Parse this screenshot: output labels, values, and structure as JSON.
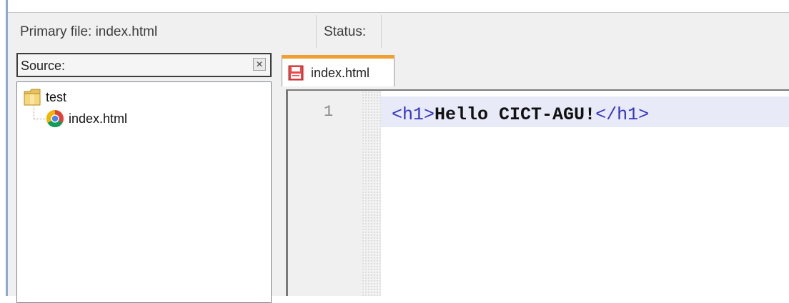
{
  "statusbar": {
    "primary_file": "Primary file: index.html",
    "status": "Status:"
  },
  "source_panel": {
    "title": "Source:",
    "close_icon": "close-icon",
    "tree": [
      {
        "label": "test",
        "icon": "folder-icon"
      },
      {
        "label": "index.html",
        "icon": "chrome-icon"
      }
    ]
  },
  "editor": {
    "tab": {
      "label": "index.html",
      "icon": "html-file-icon"
    },
    "lines": [
      {
        "number": "1",
        "tag_open": "<h1>",
        "text": "Hello CICT-AGU!",
        "tag_close": "</h1>"
      }
    ]
  },
  "colors": {
    "accent_tab": "#f0a030",
    "left_bar": "#8ea8cf",
    "code_tag": "#3333c4",
    "current_line": "#e8eaf8"
  }
}
